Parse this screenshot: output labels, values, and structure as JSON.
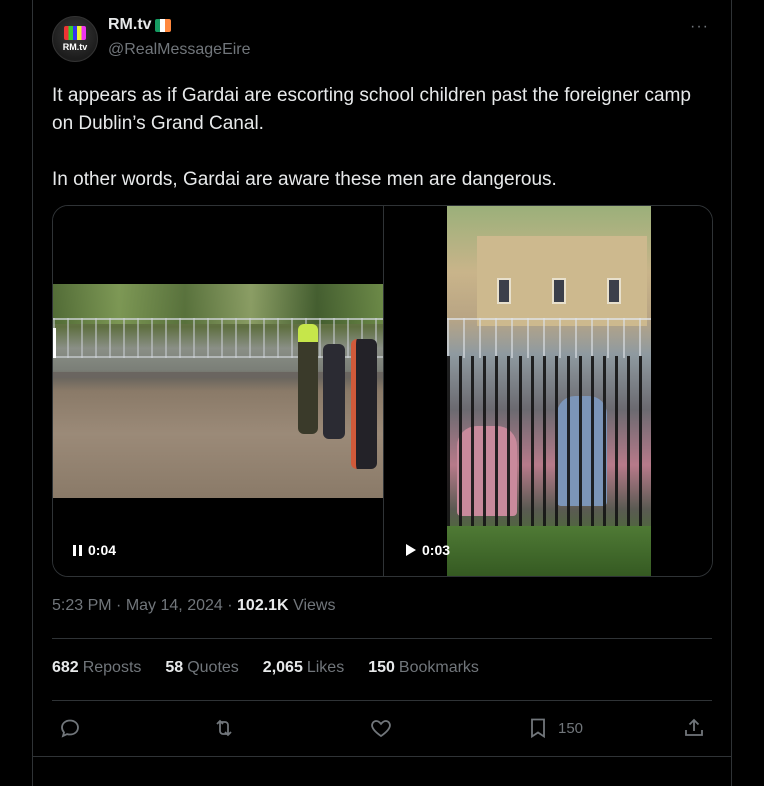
{
  "author": {
    "name": "RM.tv",
    "handle": "@RealMessageEire",
    "avatar_text": "RM.tv",
    "verified_flag": "ireland-flag-icon"
  },
  "tweet": {
    "text": "It appears as if Gardai are escorting school children past the foreigner camp on Dublin’s Grand Canal.\n\nIn other words, Gardai are aware these men are dangerous."
  },
  "media": {
    "video1": {
      "time": "0:04",
      "state": "playing",
      "icon": "pause-icon"
    },
    "video2": {
      "time": "0:03",
      "state": "paused",
      "icon": "play-icon"
    }
  },
  "meta": {
    "time": "5:23 PM",
    "separator": "·",
    "date": "May 14, 2024",
    "views_count": "102.1K",
    "views_label": "Views"
  },
  "stats": [
    {
      "count": "682",
      "label": "Reposts"
    },
    {
      "count": "58",
      "label": "Quotes"
    },
    {
      "count": "2,065",
      "label": "Likes"
    },
    {
      "count": "150",
      "label": "Bookmarks"
    }
  ],
  "actions": {
    "reply_icon": "reply-icon",
    "repost_icon": "repost-icon",
    "like_icon": "heart-icon",
    "bookmark_icon": "bookmark-icon",
    "bookmark_count": "150",
    "share_icon": "share-icon"
  },
  "more_icon": "more-dots-icon",
  "colors": {
    "background": "#000000",
    "text": "#e7e9ea",
    "muted": "#71767b",
    "border": "#2f3336"
  }
}
